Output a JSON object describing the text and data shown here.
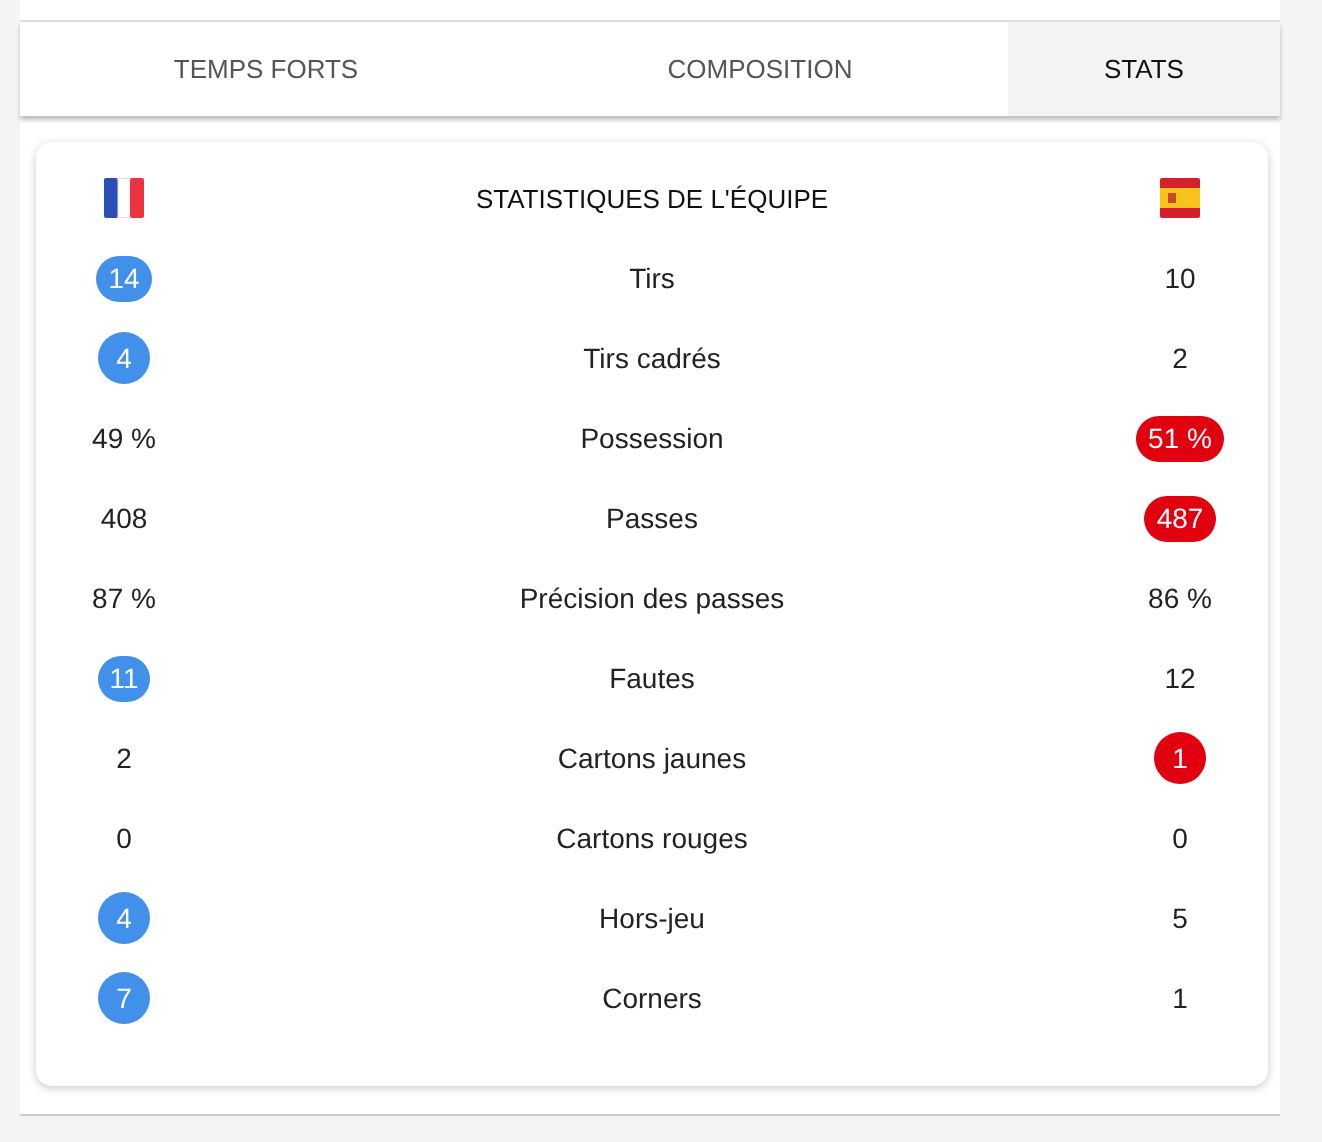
{
  "tabs": [
    {
      "label": "TEMPS FORTS",
      "selected": false
    },
    {
      "label": "COMPOSITION",
      "selected": false
    },
    {
      "label": "STATS",
      "selected": true
    }
  ],
  "teams": [
    {
      "kind": "france",
      "color": "#4190ea"
    },
    {
      "kind": "spain",
      "color": "#e0000f"
    }
  ],
  "stats_title": "STATISTIQUES DE L'ÉQUIPE",
  "stats": [
    {
      "label": "Tirs",
      "home": "14",
      "away": "10",
      "home_highlighted": true,
      "away_highlighted": false
    },
    {
      "label": "Tirs cadrés",
      "home": "4",
      "away": "2",
      "home_highlighted": true,
      "away_highlighted": false
    },
    {
      "label": "Possession",
      "home": "49 %",
      "away": "51 %",
      "home_highlighted": false,
      "away_highlighted": true
    },
    {
      "label": "Passes",
      "home": "408",
      "away": "487",
      "home_highlighted": false,
      "away_highlighted": true
    },
    {
      "label": "Précision des passes",
      "home": "87 %",
      "away": "86 %",
      "home_highlighted": false,
      "away_highlighted": false
    },
    {
      "label": "Fautes",
      "home": "11",
      "away": "12",
      "home_highlighted": true,
      "away_highlighted": false
    },
    {
      "label": "Cartons jaunes",
      "home": "2",
      "away": "1",
      "home_highlighted": false,
      "away_highlighted": true
    },
    {
      "label": "Cartons rouges",
      "home": "0",
      "away": "0",
      "home_highlighted": false,
      "away_highlighted": false
    },
    {
      "label": "Hors-jeu",
      "home": "4",
      "away": "5",
      "home_highlighted": true,
      "away_highlighted": false
    },
    {
      "label": "Corners",
      "home": "7",
      "away": "1",
      "home_highlighted": true,
      "away_highlighted": false
    }
  ]
}
